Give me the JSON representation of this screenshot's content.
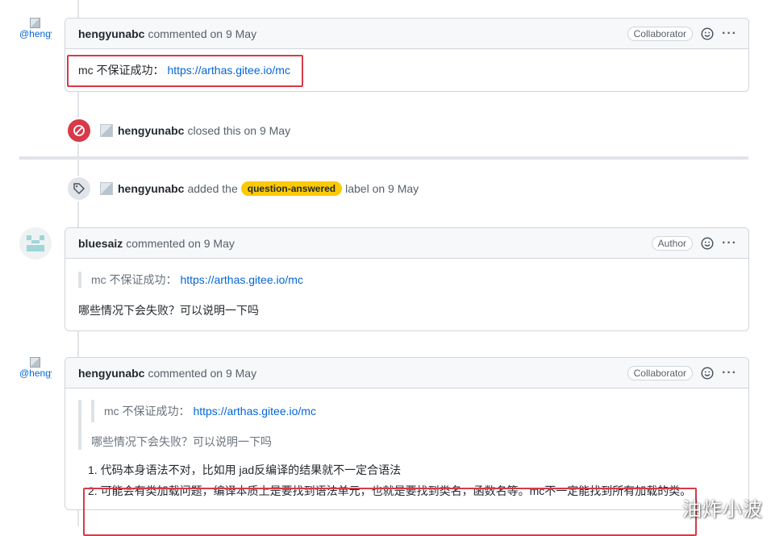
{
  "colors": {
    "link": "#0366d6",
    "closed_badge": "#d73a49",
    "label_bg": "#fbca04",
    "highlight_border": "#d73a49"
  },
  "avatar_alt": "@hengyunabc",
  "comment1": {
    "author": "hengyunabc",
    "meta": "commented on 9 May",
    "badge": "Collaborator",
    "body_text": "mc 不保证成功：",
    "body_link": "https://arthas.gitee.io/mc"
  },
  "event_closed": {
    "author": "hengyunabc",
    "text": "closed this on 9 May",
    "icon": "circle-slash-icon"
  },
  "event_label": {
    "author": "hengyunabc",
    "text_before": "added the",
    "label": "question-answered",
    "text_after": "label on 9 May",
    "icon": "tag-icon"
  },
  "comment2": {
    "author": "bluesaiz",
    "meta": "commented on 9 May",
    "badge": "Author",
    "quote_text": "mc 不保证成功：",
    "quote_link": "https://arthas.gitee.io/mc",
    "body": "哪些情况下会失败？可以说明一下吗"
  },
  "comment3": {
    "author": "hengyunabc",
    "meta": "commented on 9 May",
    "badge": "Collaborator",
    "nested_quote_text": "mc 不保证成功：",
    "nested_quote_link": "https://arthas.gitee.io/mc",
    "quote_body": "哪些情况下会失败？可以说明一下吗",
    "list": [
      "代码本身语法不对，比如用 jad反编译的结果就不一定合语法",
      "可能会有类加载问题，编译本质上是要找到语法单元，也就是要找到类名，函数名等。mc不一定能找到所有加载的类。"
    ]
  },
  "watermark": "油炸小波"
}
